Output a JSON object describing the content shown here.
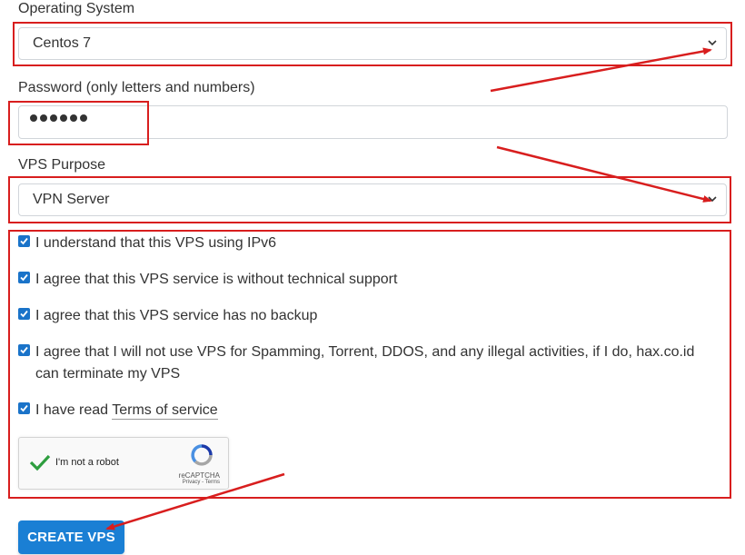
{
  "os": {
    "label": "Operating System",
    "value": "Centos 7"
  },
  "password": {
    "label": "Password (only letters and numbers)",
    "masked_length": 6
  },
  "purpose": {
    "label": "VPS Purpose",
    "value": "VPN Server"
  },
  "agreements": [
    {
      "text": "I understand that this VPS using IPv6",
      "checked": true
    },
    {
      "text": "I agree that this VPS service is without technical support",
      "checked": true
    },
    {
      "text": "I agree that this VPS service has no backup",
      "checked": true
    },
    {
      "text": "I agree that I will not use VPS for Spamming, Torrent, DDOS, and any illegal activities, if I do, hax.co.id can terminate my VPS",
      "checked": true
    },
    {
      "prefix": "I have read ",
      "link": "Terms of service",
      "checked": true
    }
  ],
  "recaptcha": {
    "label": "I'm not a robot",
    "brand": "reCAPTCHA",
    "links": "Privacy - Terms",
    "checked": true
  },
  "submit_label": "CREATE VPS",
  "colors": {
    "annotation_red": "#d81e1e",
    "checkbox_blue": "#1a73c9",
    "button_blue": "#1a7fd4",
    "recaptcha_check_green": "#2e9e3f"
  },
  "icons": [
    "chevron-down-icon",
    "checkmark-icon",
    "recaptcha-logo-icon",
    "annotation-arrow"
  ]
}
